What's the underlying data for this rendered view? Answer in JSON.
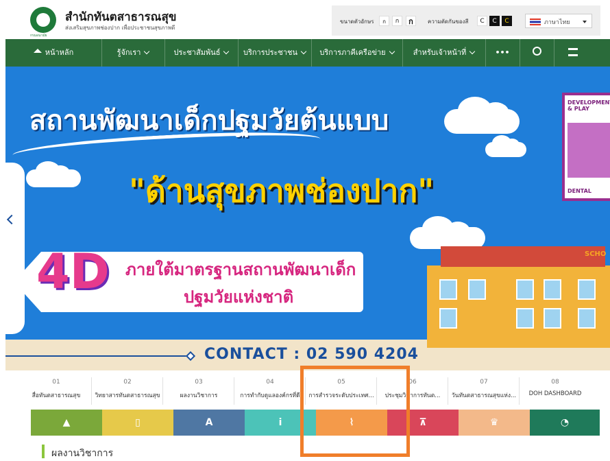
{
  "header": {
    "org_title": "สำนักทันตสาธารณสุข",
    "org_subtitle": "ส่งเสริมสุขภาพช่องปาก เพื่อประชาชนสุขภาพดี",
    "logo_text": "กรมอนามัย",
    "font_size_label": "ขนาดตัวอักษร",
    "font_size_buttons": [
      "ก",
      "ก",
      "ก"
    ],
    "contrast_label": "ความตัดกันของสี",
    "contrast_buttons": [
      "C",
      "C",
      "C"
    ],
    "language": "ภาษาไทย"
  },
  "nav": {
    "items": [
      {
        "label": "หน้าหลัก",
        "icon": "home-icon"
      },
      {
        "label": "รู้จักเรา",
        "dropdown": true
      },
      {
        "label": "ประชาสัมพันธ์",
        "dropdown": true
      },
      {
        "label": "บริการประชาชน",
        "dropdown": true
      },
      {
        "label": "บริการภาคีเครือข่าย",
        "dropdown": true
      },
      {
        "label": "สำหรับเจ้าหน้าที่",
        "dropdown": true
      }
    ],
    "more": "•••",
    "search_icon": "search-icon",
    "sitemap_icon": "sitemap-icon"
  },
  "hero": {
    "line1": "สถานพัฒนาเด็กปฐมวัยต้นแบบ",
    "line2": "\"ด้านสุขภาพช่องปาก\"",
    "badge": "4D",
    "banner_line1": "ภายใต้มาตรฐานสถานพัฒนาเด็ก",
    "banner_line2": "ปฐมวัยแห่งชาติ",
    "card_top": "DEVELOPMENT & PLAY",
    "card_bottom": "DENTAL",
    "school_sign": "SCHO",
    "contact": "CONTACT : 02 590 4204"
  },
  "tabs": [
    {
      "num": "01",
      "label": "สื่อทันตสาธารณสุข",
      "color": "#7ba83a",
      "icon": "▲"
    },
    {
      "num": "02",
      "label": "วิทยาสารทันตสาธารณสุข",
      "color": "#e6c94a",
      "icon": "▯"
    },
    {
      "num": "03",
      "label": "ผลงานวิชาการ",
      "color": "#4f77a3",
      "icon": "A"
    },
    {
      "num": "04",
      "label": "การทำกับดูแลองค์กรที่ดี",
      "color": "#4cc3b8",
      "icon": "i"
    },
    {
      "num": "05",
      "label": "การสำรวจระดับประเทศ...",
      "color": "#f49a4a",
      "icon": "⌇"
    },
    {
      "num": "06",
      "label": "ประชุมวิชาการทันต...",
      "color": "#d9465a",
      "icon": "⊼"
    },
    {
      "num": "07",
      "label": "วันทันตสาธารณสุขแห่ง...",
      "color": "#f3b98a",
      "icon": "♛"
    },
    {
      "num": "08",
      "label": "DOH DASHBOARD",
      "color": "#1f7a5a",
      "icon": "◔"
    }
  ],
  "section_heading": "ผลงานวิชาการ"
}
